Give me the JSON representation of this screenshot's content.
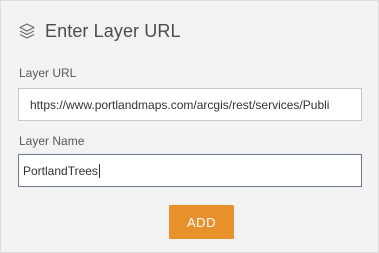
{
  "dialog": {
    "title": "Enter Layer URL",
    "title_icon": "layers-icon"
  },
  "form": {
    "url_label": "Layer URL",
    "url_value": "https://www.portlandmaps.com/arcgis/rest/services/Publi",
    "name_label": "Layer Name",
    "name_value": "PortlandTrees"
  },
  "actions": {
    "add_label": "ADD"
  },
  "colors": {
    "accent": "#e8912b",
    "panel_bg": "#f3f3f3"
  }
}
